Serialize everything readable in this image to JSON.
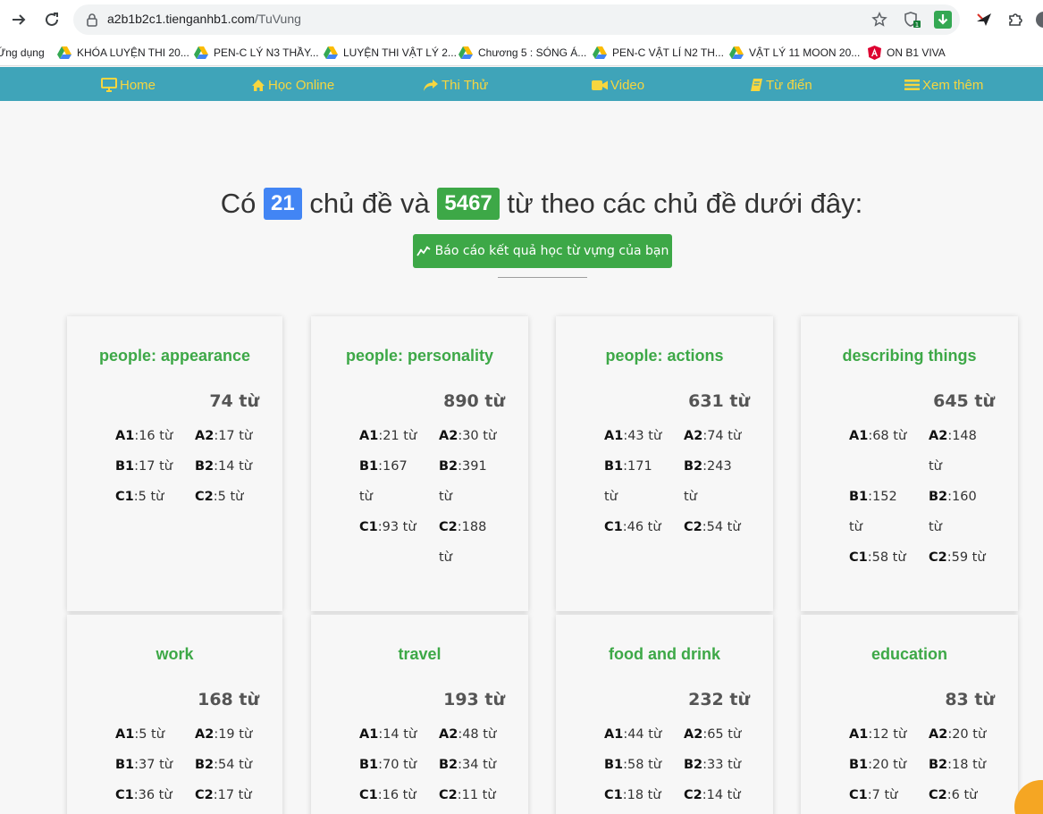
{
  "browser": {
    "url_host": "a2b1b2c1.tienganhb1.com",
    "url_path": "/TuVung"
  },
  "bookmarks": [
    {
      "label": "Ứng dụng",
      "icon": "apps-icon"
    },
    {
      "label": "KHÓA LUYỆN THI 20...",
      "icon": "google-drive-icon"
    },
    {
      "label": "PEN-C LÝ N3 THẦY...",
      "icon": "google-drive-icon"
    },
    {
      "label": "LUYỆN THI VẬT LÝ 2...",
      "icon": "google-drive-icon"
    },
    {
      "label": "Chương 5 : SÓNG Á...",
      "icon": "google-drive-icon"
    },
    {
      "label": "PEN-C VẬT LÍ N2 TH...",
      "icon": "google-drive-icon"
    },
    {
      "label": "VẬT LÝ 11 MOON 20...",
      "icon": "google-drive-icon"
    },
    {
      "label": "ON B1 VIVA",
      "icon": "angular-icon"
    }
  ],
  "nav": [
    {
      "label": "Home",
      "icon": "monitor-icon"
    },
    {
      "label": "Học Online",
      "icon": "home-icon"
    },
    {
      "label": "Thi Thử",
      "icon": "share-icon"
    },
    {
      "label": "Video",
      "icon": "video-icon"
    },
    {
      "label": "Từ điển",
      "icon": "book-icon"
    },
    {
      "label": "Xem thêm",
      "icon": "menu-icon"
    }
  ],
  "heading": {
    "prefix": "Có",
    "topic_count": "21",
    "middle": "chủ đề và",
    "word_count": "5467",
    "suffix": "từ theo các chủ đề dưới đây:"
  },
  "report_button": "Báo cáo kết quả học từ vựng của bạn",
  "topics": [
    {
      "title": "people: appearance",
      "total": "74 từ",
      "levels": [
        {
          "k": "A1",
          "v": ":16 từ"
        },
        {
          "k": "A2",
          "v": ":17 từ"
        },
        {
          "k": "B1",
          "v": ":17 từ"
        },
        {
          "k": "B2",
          "v": ":14 từ"
        },
        {
          "k": "C1",
          "v": ":5 từ"
        },
        {
          "k": "C2",
          "v": ":5 từ"
        }
      ]
    },
    {
      "title": "people: personality",
      "total": "890 từ",
      "levels": [
        {
          "k": "A1",
          "v": ":21 từ"
        },
        {
          "k": "A2",
          "v": ":30 từ"
        },
        {
          "k": "B1",
          "v": ":167 từ"
        },
        {
          "k": "B2",
          "v": ":391 từ"
        },
        {
          "k": "C1",
          "v": ":93 từ"
        },
        {
          "k": "C2",
          "v": ":188 từ"
        }
      ]
    },
    {
      "title": "people: actions",
      "total": "631 từ",
      "levels": [
        {
          "k": "A1",
          "v": ":43 từ"
        },
        {
          "k": "A2",
          "v": ":74 từ"
        },
        {
          "k": "B1",
          "v": ":171 từ"
        },
        {
          "k": "B2",
          "v": ":243 từ"
        },
        {
          "k": "C1",
          "v": ":46 từ"
        },
        {
          "k": "C2",
          "v": ":54 từ"
        }
      ]
    },
    {
      "title": "describing things",
      "total": "645 từ",
      "levels": [
        {
          "k": "A1",
          "v": ":68 từ"
        },
        {
          "k": "A2",
          "v": ":148 từ"
        },
        {
          "k": "B1",
          "v": ":152 từ"
        },
        {
          "k": "B2",
          "v": ":160 từ"
        },
        {
          "k": "C1",
          "v": ":58 từ"
        },
        {
          "k": "C2",
          "v": ":59 từ"
        }
      ]
    },
    {
      "title": "work",
      "total": "168 từ",
      "levels": [
        {
          "k": "A1",
          "v": ":5 từ"
        },
        {
          "k": "A2",
          "v": ":19 từ"
        },
        {
          "k": "B1",
          "v": ":37 từ"
        },
        {
          "k": "B2",
          "v": ":54 từ"
        },
        {
          "k": "C1",
          "v": ":36 từ"
        },
        {
          "k": "C2",
          "v": ":17 từ"
        }
      ]
    },
    {
      "title": "travel",
      "total": "193 từ",
      "levels": [
        {
          "k": "A1",
          "v": ":14 từ"
        },
        {
          "k": "A2",
          "v": ":48 từ"
        },
        {
          "k": "B1",
          "v": ":70 từ"
        },
        {
          "k": "B2",
          "v": ":34 từ"
        },
        {
          "k": "C1",
          "v": ":16 từ"
        },
        {
          "k": "C2",
          "v": ":11 từ"
        }
      ]
    },
    {
      "title": "food and drink",
      "total": "232 từ",
      "levels": [
        {
          "k": "A1",
          "v": ":44 từ"
        },
        {
          "k": "A2",
          "v": ":65 từ"
        },
        {
          "k": "B1",
          "v": ":58 từ"
        },
        {
          "k": "B2",
          "v": ":33 từ"
        },
        {
          "k": "C1",
          "v": ":18 từ"
        },
        {
          "k": "C2",
          "v": ":14 từ"
        }
      ]
    },
    {
      "title": "education",
      "total": "83 từ",
      "levels": [
        {
          "k": "A1",
          "v": ":12 từ"
        },
        {
          "k": "A2",
          "v": ":20 từ"
        },
        {
          "k": "B1",
          "v": ":20 từ"
        },
        {
          "k": "B2",
          "v": ":18 từ"
        },
        {
          "k": "C1",
          "v": ":7 từ"
        },
        {
          "k": "C2",
          "v": ":6 từ"
        }
      ]
    }
  ],
  "colors": {
    "nav_bg": "#3fa4b9",
    "nav_text": "#f7d63f",
    "accent_green": "#3da847",
    "accent_blue": "#4285f4"
  }
}
